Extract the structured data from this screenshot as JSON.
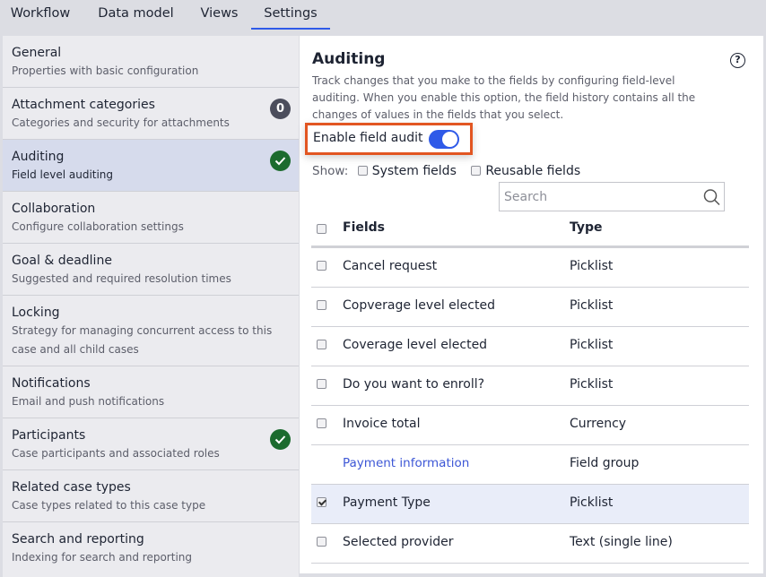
{
  "tabs": [
    {
      "label": "Workflow",
      "active": false
    },
    {
      "label": "Data model",
      "active": false
    },
    {
      "label": "Views",
      "active": false
    },
    {
      "label": "Settings",
      "active": true
    }
  ],
  "sidebar": {
    "items": [
      {
        "title": "General",
        "desc": "Properties with basic configuration",
        "badge": null
      },
      {
        "title": "Attachment categories",
        "desc": "Categories and security for attachments",
        "badge": "0"
      },
      {
        "title": "Auditing",
        "desc": "Field level auditing",
        "badge": "check",
        "active": true
      },
      {
        "title": "Collaboration",
        "desc": "Configure collaboration settings",
        "badge": null
      },
      {
        "title": "Goal & deadline",
        "desc": "Suggested and required resolution times",
        "badge": null
      },
      {
        "title": "Locking",
        "desc": "Strategy for managing concurrent access to this case and all child cases",
        "badge": null
      },
      {
        "title": "Notifications",
        "desc": "Email and push notifications",
        "badge": null
      },
      {
        "title": "Participants",
        "desc": "Case participants and associated roles",
        "badge": "check"
      },
      {
        "title": "Related case types",
        "desc": "Case types related to this case type",
        "badge": null
      },
      {
        "title": "Search and reporting",
        "desc": "Indexing for search and reporting",
        "badge": null
      }
    ]
  },
  "main": {
    "title": "Auditing",
    "help_icon": "?",
    "description": "Track changes that you make to the fields by configuring field-level auditing. When you enable this option, the field history contains all the changes of values in the fields that you select.",
    "enable_audit_label": "Enable field audit",
    "enable_audit_on": true,
    "show_label": "Show:",
    "show_options": [
      {
        "label": "System fields",
        "checked": false
      },
      {
        "label": "Reusable fields",
        "checked": false
      }
    ],
    "search": {
      "placeholder": "Search",
      "value": ""
    },
    "table": {
      "headers": {
        "fields": "Fields",
        "type": "Type"
      },
      "rows": [
        {
          "field": "Cancel request",
          "type": "Picklist",
          "checked": false,
          "checkbox": true
        },
        {
          "field": "Copverage level elected",
          "type": "Picklist",
          "checked": false,
          "checkbox": true
        },
        {
          "field": "Coverage level elected",
          "type": "Picklist",
          "checked": false,
          "checkbox": true
        },
        {
          "field": "Do you want to enroll?",
          "type": "Picklist",
          "checked": false,
          "checkbox": true
        },
        {
          "field": "Invoice total",
          "type": "Currency",
          "checked": false,
          "checkbox": true
        },
        {
          "field": "Payment information",
          "type": "Field group",
          "checked": false,
          "checkbox": false,
          "link": true
        },
        {
          "field": "Payment Type",
          "type": "Picklist",
          "checked": true,
          "checkbox": true,
          "selected": true
        },
        {
          "field": "Selected provider",
          "type": "Text (single line)",
          "checked": false,
          "checkbox": true
        }
      ]
    }
  },
  "colors": {
    "accent": "#2f5ae8",
    "highlight_border": "#e25622",
    "success": "#1c6b2e",
    "badge": "#4b4d5c",
    "link": "#3d57d6"
  }
}
